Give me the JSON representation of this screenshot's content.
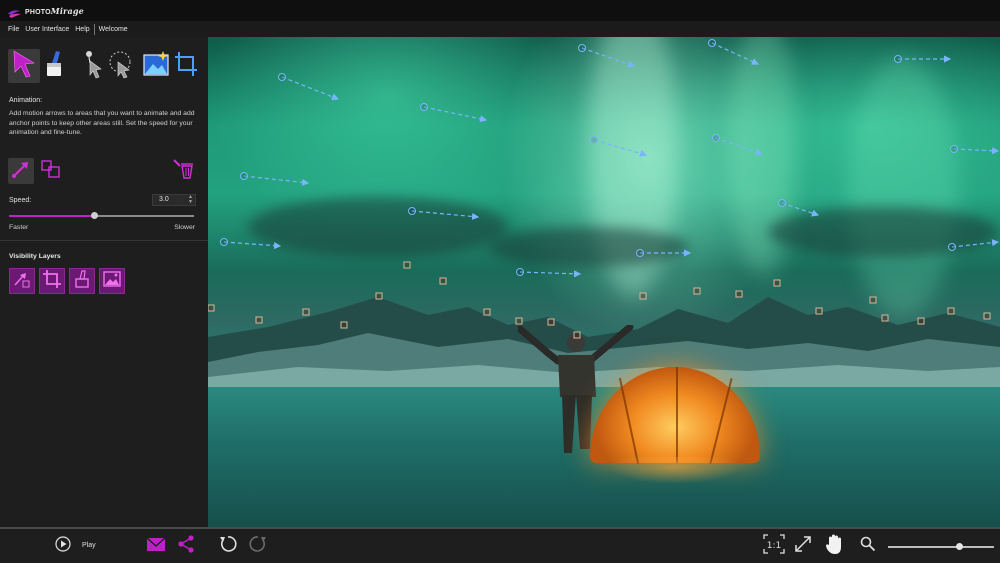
{
  "app": {
    "logo_small": "PHOTO",
    "logo_name": "Mirage"
  },
  "menu": [
    "File",
    "User Interface",
    "Help",
    "Welcome"
  ],
  "tools": [
    {
      "name": "animate-tool",
      "icon": "motion-arrow-icon",
      "active": true
    },
    {
      "name": "mask-tool",
      "icon": "eraser-brush-icon",
      "active": false
    },
    {
      "name": "select-tool",
      "icon": "pin-pointer-icon",
      "active": false
    },
    {
      "name": "lasso-tool",
      "icon": "lasso-select-icon",
      "active": false
    },
    {
      "name": "image-tool",
      "icon": "image-sparkle-icon",
      "active": false
    },
    {
      "name": "crop-tool",
      "icon": "crop-icon",
      "active": false
    }
  ],
  "animation": {
    "heading": "Animation:",
    "description": "Add motion arrows to areas that you want to animate and add anchor points to keep other areas still. Set the speed for your animation and fine-tune."
  },
  "speed": {
    "label": "Speed:",
    "value": "3.0",
    "level": 0.46,
    "left_label": "Faster",
    "right_label": "Slower"
  },
  "visibility": {
    "heading": "Visibility Layers",
    "layers": [
      "motion-layer-icon",
      "crop-layer-icon",
      "mask-layer-icon",
      "image-layer-icon"
    ]
  },
  "playback": {
    "play_label": "Play"
  },
  "zoom": {
    "level": 0.64
  },
  "colors": {
    "accent": "#c020c8",
    "arrow": "#7ab4ff",
    "anchor": "#c8a88a"
  }
}
